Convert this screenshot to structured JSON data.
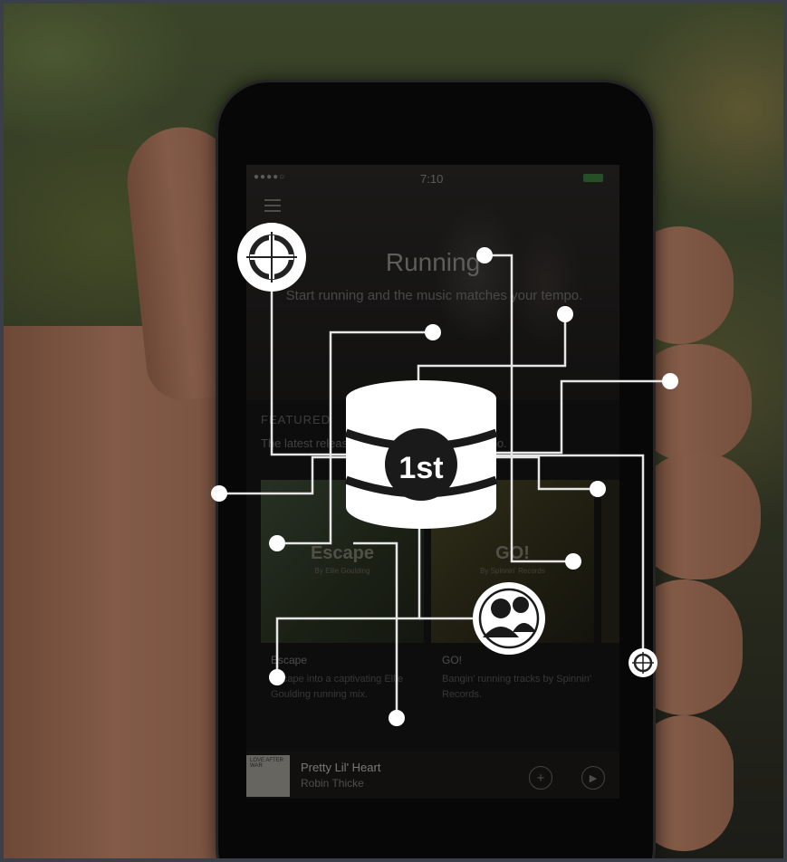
{
  "status": {
    "signal": "●●●●○",
    "time": "7:10"
  },
  "hero": {
    "title": "Running",
    "subtitle": "Start running and the music matches your tempo."
  },
  "featured": {
    "heading": "FEATURED",
    "subtitle": "The latest releases ready to match your tempo."
  },
  "cards": [
    {
      "art_title": "Escape",
      "art_by": "By Ellie Goulding",
      "name": "Escape",
      "desc": "Escape into a captivating Ellie Goulding running mix."
    },
    {
      "art_title": "GO!",
      "art_by": "By Spinnin' Records",
      "name": "GO!",
      "desc": "Bangin' running tracks by Spinnin' Records."
    }
  ],
  "now_playing": {
    "song": "Pretty Lil' Heart",
    "artist": "Robin Thicke",
    "art_label": "LOVE AFTER WAR"
  },
  "overlay": {
    "badge_text": "1st"
  }
}
